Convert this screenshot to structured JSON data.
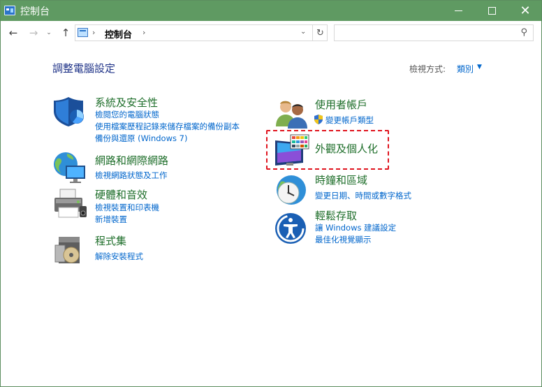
{
  "window": {
    "title": "控制台",
    "colors": {
      "titlebar": "#5f9a62",
      "link": "#0066cc",
      "category": "#1e6e2a",
      "highlight": "#e0141e"
    }
  },
  "controls": {
    "minimize": "minimize-icon",
    "maximize": "maximize-icon",
    "close": "✕"
  },
  "nav": {
    "back": "←",
    "forward": "→",
    "dropdown": "⌄",
    "up": "↑",
    "address": "控制台",
    "address_separator": "›",
    "refresh": "↻",
    "search_placeholder": "",
    "search_icon": "⚲"
  },
  "content": {
    "page_title": "調整電腦設定",
    "view_by_label": "檢視方式:",
    "view_by_value": "類別",
    "view_by_arrow": "▼"
  },
  "categories": [
    {
      "title": "系統及安全性",
      "icon": "shield-icon",
      "links": [
        "檢閱您的電腦狀態",
        "使用檔案歷程記錄來儲存檔案的備份副本",
        "備份與還原 (Windows 7)"
      ]
    },
    {
      "title": "網路和網際網路",
      "icon": "network-icon",
      "links": [
        "檢視網路狀態及工作"
      ]
    },
    {
      "title": "硬體和音效",
      "icon": "printer-icon",
      "links": [
        "檢視裝置和印表機",
        "新增裝置"
      ]
    },
    {
      "title": "程式集",
      "icon": "programs-icon",
      "links": [
        "解除安裝程式"
      ]
    },
    {
      "title": "使用者帳戶",
      "icon": "users-icon",
      "links": [
        "變更帳戶類型"
      ]
    },
    {
      "title": "外觀及個人化",
      "icon": "appearance-icon",
      "links": []
    },
    {
      "title": "時鐘和區域",
      "icon": "clock-icon",
      "links": [
        "變更日期、時間或數字格式"
      ]
    },
    {
      "title": "輕鬆存取",
      "icon": "accessibility-icon",
      "links": [
        "讓 Windows 建議設定",
        "最佳化視覺顯示"
      ]
    }
  ]
}
